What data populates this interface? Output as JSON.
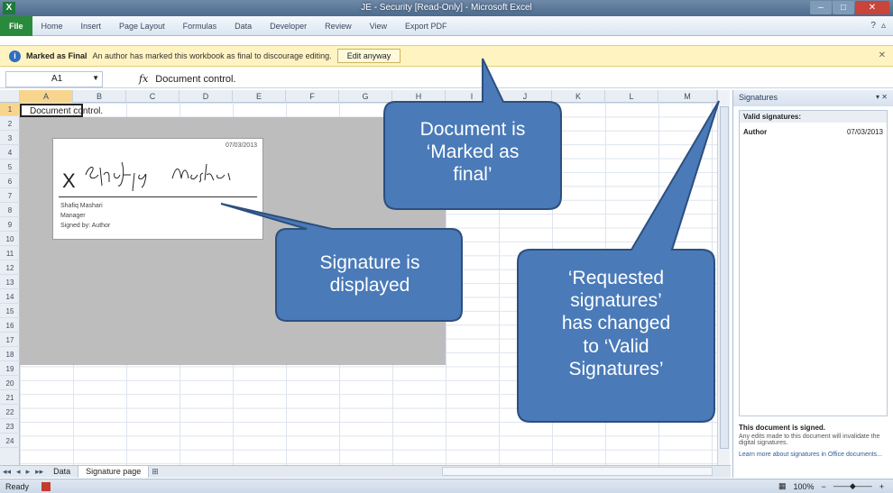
{
  "window": {
    "title": "JE - Security [Read-Only] - Microsoft Excel",
    "app_icon": "X",
    "controls": [
      "–",
      "□",
      "✕"
    ]
  },
  "ribbon": {
    "file_tab": "File",
    "tabs": [
      "Home",
      "Insert",
      "Page Layout",
      "Formulas",
      "Data",
      "Developer",
      "Review",
      "View",
      "Export PDF"
    ]
  },
  "message_bar": {
    "title": "Marked as Final",
    "text": "An author has marked this workbook as final to discourage editing.",
    "button": "Edit anyway"
  },
  "formula_bar": {
    "name_box": "A1",
    "fx": "fx",
    "formula": "Document control."
  },
  "columns": [
    "A",
    "B",
    "C",
    "D",
    "E",
    "F",
    "G",
    "H",
    "I",
    "J",
    "K",
    "L",
    "M"
  ],
  "rows": [
    "1",
    "2",
    "3",
    "4",
    "5",
    "6",
    "7",
    "8",
    "9",
    "10",
    "11",
    "12",
    "13",
    "14",
    "15",
    "16",
    "17",
    "18",
    "19",
    "20",
    "21",
    "22",
    "23",
    "24"
  ],
  "cell_a1": "Document control.",
  "signature_line": {
    "date": "07/03/2013",
    "x_mark": "X",
    "name": "Shafiq Mashari",
    "title": "Manager",
    "signed_by": "Signed by: Author"
  },
  "sheet_tabs": [
    "Data",
    "Signature page"
  ],
  "status_bar": {
    "mode": "Ready",
    "zoom": "100%"
  },
  "signatures_pane": {
    "title": "Signatures",
    "group_header": "Valid signatures:",
    "signer": "Author",
    "signed_date": "07/03/2013",
    "footer_title": "This document is signed.",
    "footer_text": "Any edits made to this document will invalidate the digital signatures.",
    "learn_more": "Learn more about signatures in Office documents..."
  },
  "callouts": {
    "marked_final": [
      "Document is",
      "‘Marked as",
      "final’"
    ],
    "signature_displayed": [
      "Signature is",
      "displayed"
    ],
    "requested_changed": [
      "‘Requested",
      "signatures’",
      "has changed",
      "to ‘Valid",
      "Signatures’"
    ]
  },
  "colors": {
    "callout_fill": "#4a7ab8",
    "callout_border": "#2c4f7e",
    "message_bar": "#fff4c1",
    "gray_area": "#bdbdbd"
  }
}
